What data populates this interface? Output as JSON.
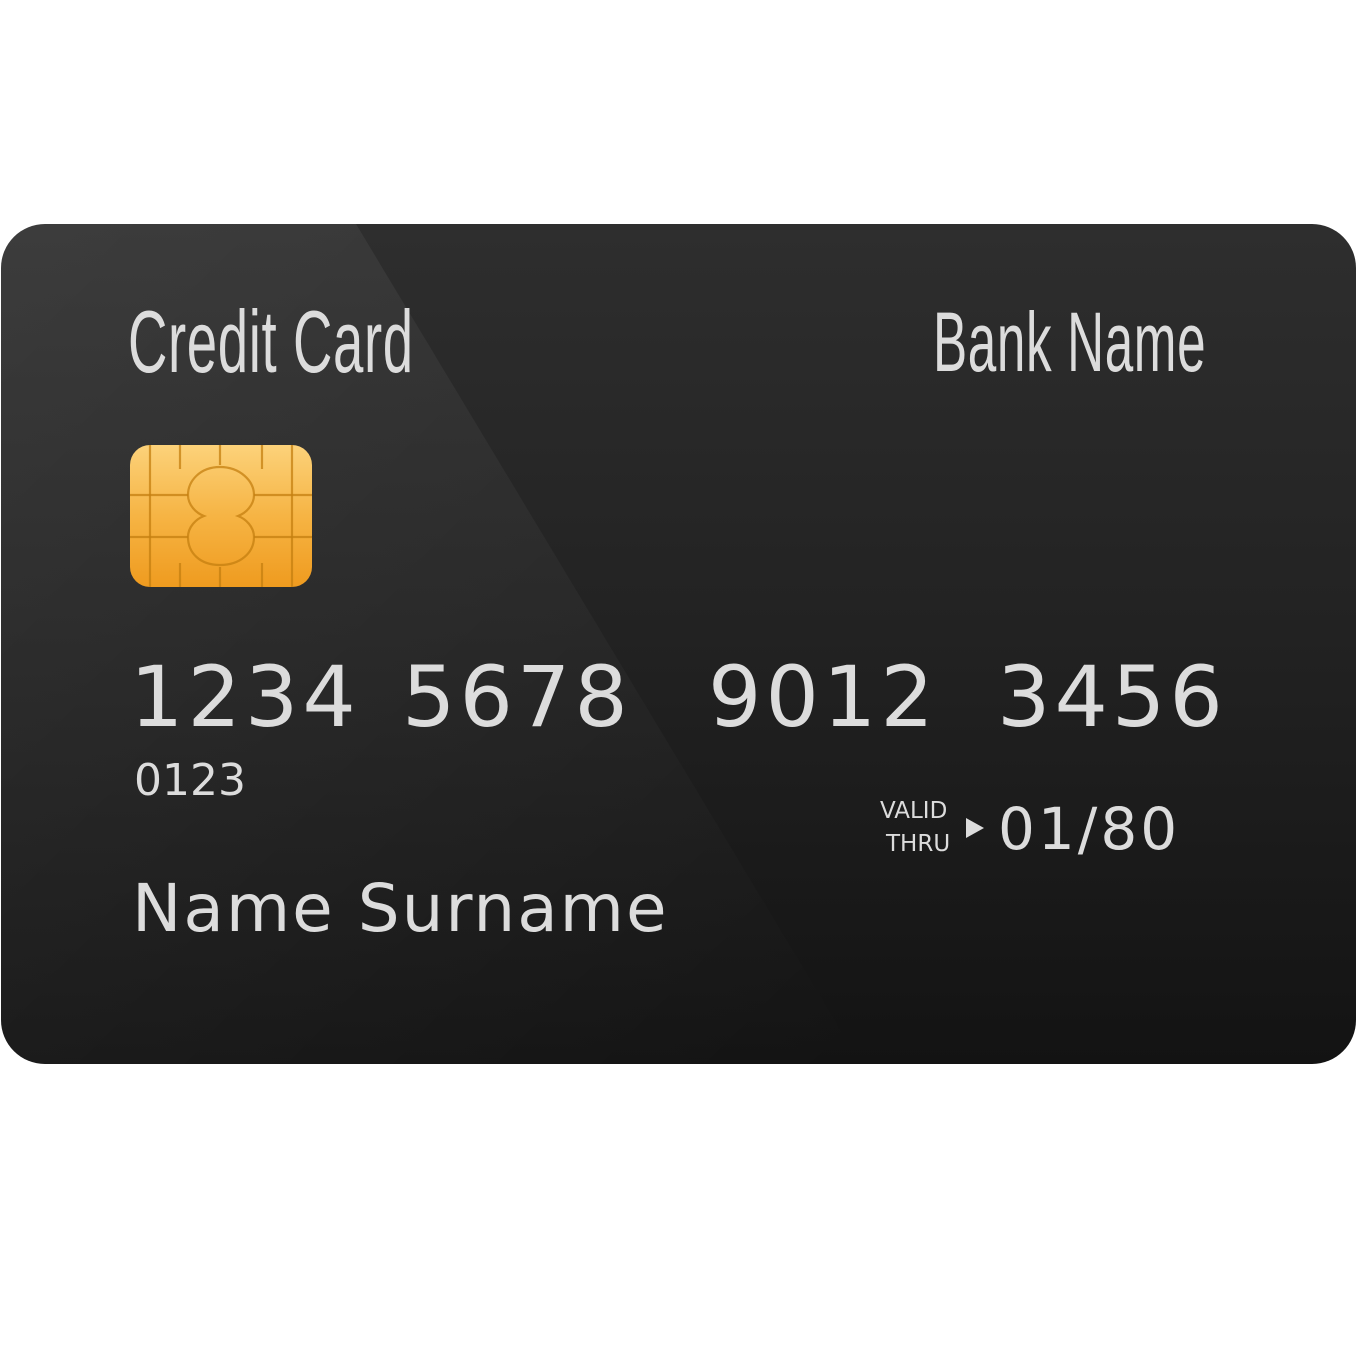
{
  "card": {
    "type_label": "Credit Card",
    "bank_name": "Bank Name",
    "number_groups": [
      "1234",
      "5678",
      "9012",
      "3456"
    ],
    "small_number": "0123",
    "valid_thru_line1": "VALID",
    "valid_thru_line2": "THRU",
    "expiry": "01/80",
    "holder_name": "Name Surname"
  },
  "colors": {
    "card_body": "#262626",
    "text": "#dcdcdc",
    "chip_gold": "#f5a623"
  },
  "icons": {
    "chip": "emv-chip-icon",
    "arrow": "triangle-right-icon"
  }
}
